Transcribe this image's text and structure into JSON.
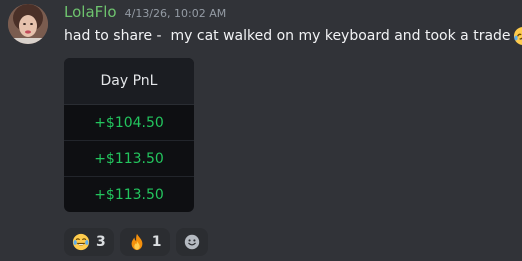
{
  "message": {
    "author": "LolaFlo",
    "timestamp": "4/13/26, 10:02 AM",
    "text": "had to share -  my cat walked on my keyboard and took a trade",
    "inline_emoji": "rolling-on-floor-laughing-icon",
    "author_color": "#6ec36e"
  },
  "attachment": {
    "header": "Day PnL",
    "rows": [
      "+$104.50",
      "+$113.50",
      "+$113.50"
    ],
    "value_color": "#23c55e"
  },
  "reactions": [
    {
      "emoji": "joy-icon",
      "count": "3"
    },
    {
      "emoji": "fire-icon",
      "count": "1"
    },
    {
      "emoji": "add-reaction-icon",
      "count": ""
    }
  ]
}
